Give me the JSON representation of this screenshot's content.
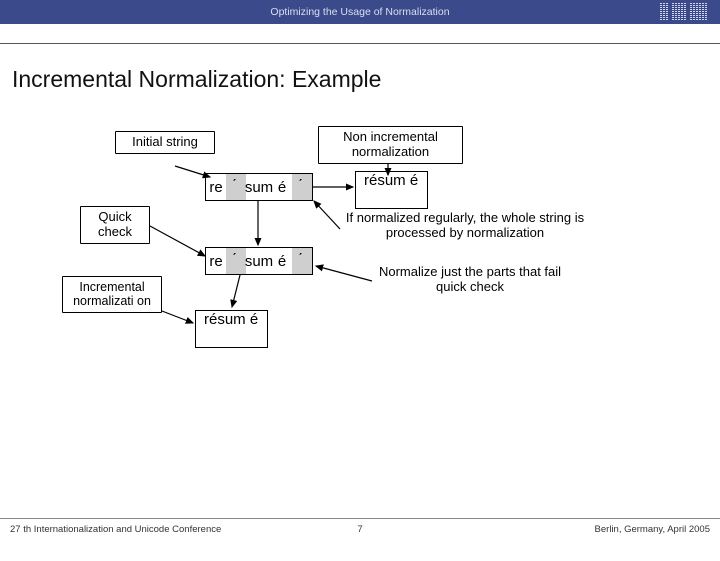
{
  "header": {
    "title": "Optimizing the Usage of Normalization",
    "logo_alt": "IBM"
  },
  "slide": {
    "title": "Incremental Normalization: Example"
  },
  "labels": {
    "initial": "Initial string",
    "non_incremental": "Non incremental normalization",
    "quick_check": "Quick check",
    "incremental_norm": "Incremental\nnormalizati\non"
  },
  "sequences": {
    "seq1": [
      "re",
      "́",
      "sum",
      "é",
      "́"
    ],
    "seq2": [
      "re",
      "́",
      "sum",
      "é",
      "́"
    ],
    "result_right": "résum\né",
    "result_bottom": "résum\né"
  },
  "notes": {
    "regular": "If normalized regularly, the whole string is processed by normalization",
    "just_parts": "Normalize just the parts that fail quick check"
  },
  "footer": {
    "left": "27 th Internationalization and Unicode Conference",
    "center": "7",
    "right": "Berlin, Germany, April 2005"
  }
}
